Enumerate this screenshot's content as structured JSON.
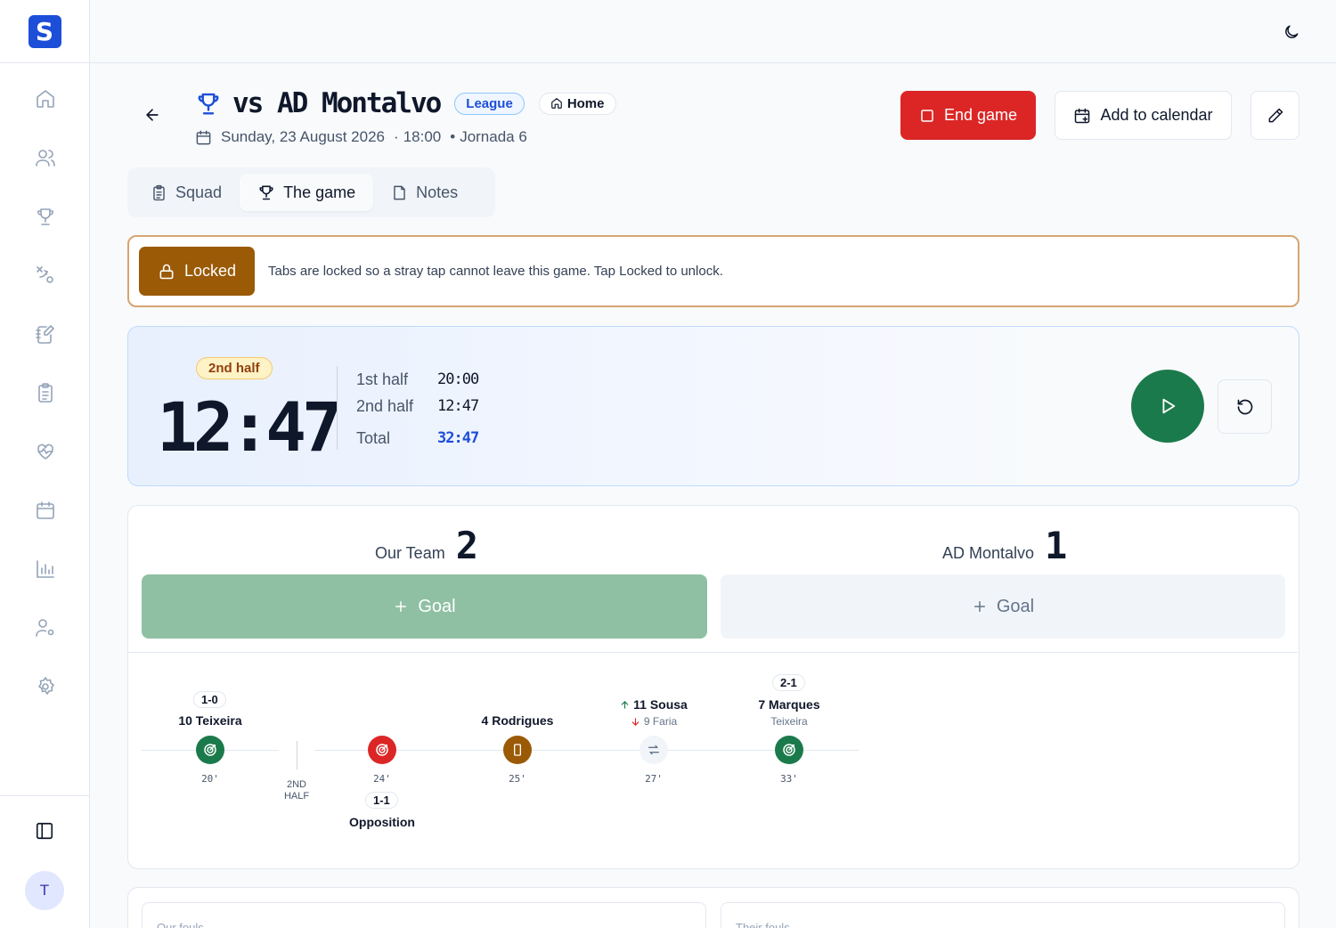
{
  "app": {
    "logo_letter": "S"
  },
  "sidebar": {
    "items": [
      {
        "icon": "home-icon"
      },
      {
        "icon": "users-icon"
      },
      {
        "icon": "trophy-icon"
      },
      {
        "icon": "tactics-icon"
      },
      {
        "icon": "notebook-icon"
      },
      {
        "icon": "clipboard-icon"
      },
      {
        "icon": "heart-pulse-icon"
      },
      {
        "icon": "calendar-icon"
      },
      {
        "icon": "bar-chart-icon"
      },
      {
        "icon": "user-settings-icon"
      },
      {
        "icon": "gear-icon"
      }
    ],
    "avatar_initial": "T"
  },
  "header": {
    "title": "vs AD Montalvo",
    "competition": "League",
    "venue": "Home",
    "date": "Sunday, 23 August 2026",
    "time": "18:00",
    "round": "Jornada 6",
    "end_game_label": "End game",
    "add_calendar_label": "Add to calendar"
  },
  "tabs": [
    {
      "label": "Squad",
      "active": false
    },
    {
      "label": "The game",
      "active": true
    },
    {
      "label": "Notes",
      "active": false
    }
  ],
  "lock": {
    "button_label": "Locked",
    "message": "Tabs are locked so a stray tap cannot leave this game. Tap Locked to unlock."
  },
  "timer": {
    "period_badge": "2nd half",
    "clock": "12:47",
    "splits": [
      {
        "label": "1st half",
        "value": "20:00"
      },
      {
        "label": "2nd half",
        "value": "12:47"
      }
    ],
    "total_label": "Total",
    "total_value": "32:47"
  },
  "score": {
    "home": {
      "name": "Our Team",
      "score": "2",
      "goal_label": "Goal"
    },
    "away": {
      "name": "AD Montalvo",
      "score": "1",
      "goal_label": "Goal"
    }
  },
  "timeline": {
    "halftime_label": "2ND HALF",
    "events": [
      {
        "type": "goal",
        "team": "home",
        "minute": "20'",
        "score": "1-0",
        "player": "10 Teixeira",
        "color": "#1b7a4b"
      },
      {
        "type": "goal",
        "team": "away",
        "minute": "24'",
        "score": "1-1",
        "player": "Opposition",
        "color": "#dc2626"
      },
      {
        "type": "yellow-card",
        "team": "home",
        "minute": "25'",
        "player": "4 Rodrigues",
        "color": "#9a5a06"
      },
      {
        "type": "substitution",
        "team": "home",
        "minute": "27'",
        "player_in": "11 Sousa",
        "player_out": "9 Faria"
      },
      {
        "type": "goal",
        "team": "home",
        "minute": "33'",
        "score": "2-1",
        "player": "7 Marques",
        "assist": "Teixeira",
        "color": "#1b7a4b"
      }
    ]
  },
  "fouls": {
    "ours_label": "Our fouls",
    "theirs_label": "Their fouls"
  },
  "colors": {
    "accent": "#1d4ed8",
    "danger": "#dc2626",
    "success": "#1b7a4b",
    "locked": "#9a5a06"
  }
}
